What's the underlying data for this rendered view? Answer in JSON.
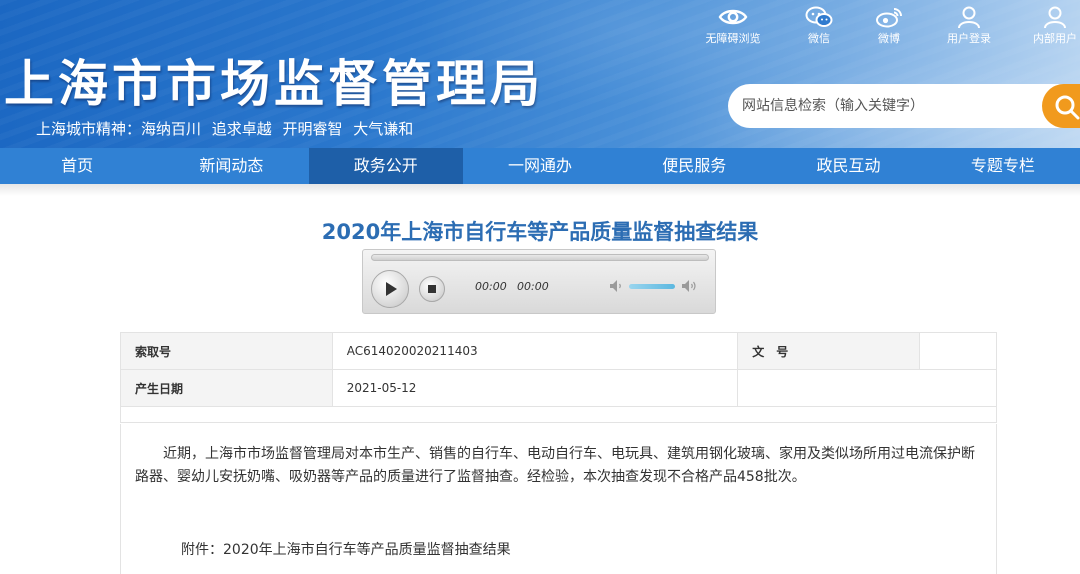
{
  "header": {
    "site_title": "上海市市场监督管理局",
    "slogan": "上海城市精神：海纳百川  追求卓越  开明睿智  大气谦和",
    "toplinks": [
      {
        "label": "无障碍浏览",
        "icon": "eye-icon"
      },
      {
        "label": "微信",
        "icon": "wechat-icon"
      },
      {
        "label": "微博",
        "icon": "weibo-icon"
      },
      {
        "label": "用户登录",
        "icon": "user-icon"
      },
      {
        "label": "内部用户",
        "icon": "user-icon"
      }
    ],
    "search": {
      "placeholder": "网站信息检索（输入关键字）",
      "button_icon": "search-icon"
    }
  },
  "nav": {
    "items": [
      {
        "label": "首页"
      },
      {
        "label": "新闻动态"
      },
      {
        "label": "政务公开"
      },
      {
        "label": "一网通办"
      },
      {
        "label": "便民服务"
      },
      {
        "label": "政民互动"
      },
      {
        "label": "专题专栏"
      }
    ],
    "active_index": 2
  },
  "article": {
    "title": "2020年上海市自行车等产品质量监督抽查结果",
    "player": {
      "current_time": "00:00",
      "total_time": "00:00",
      "play_icon": "play-icon",
      "stop_icon": "stop-icon",
      "mute_icon": "volume-mute-icon",
      "max_volume_icon": "volume-max-icon"
    },
    "info": {
      "index_label": "索取号",
      "index_value": "AC614020020211403",
      "doc_no_label": "文　号",
      "doc_no_value": "",
      "date_label": "产生日期",
      "date_value": "2021-05-12"
    },
    "paragraph": "近期，上海市市场监督管理局对本市生产、销售的自行车、电动自行车、电玩具、建筑用钢化玻璃、家用及类似场所用过电流保护断路器、婴幼儿安抚奶嘴、吸奶器等产品的质量进行了监督抽查。经检验，本次抽查发现不合格产品458批次。",
    "attachment_prefix": "附件：",
    "attachment_link": "2020年上海市自行车等产品质量监督抽查结果"
  },
  "colors": {
    "header_blue": "#2b78cd",
    "nav_blue": "#3081d4",
    "nav_active": "#1e5fa8",
    "title_blue": "#2c6db3",
    "search_orange": "#f19a1d"
  }
}
